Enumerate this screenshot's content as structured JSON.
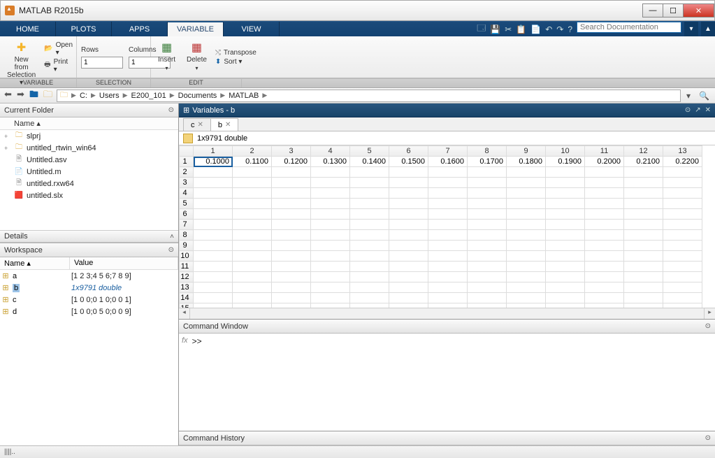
{
  "window": {
    "title": "MATLAB R2015b"
  },
  "tabs": {
    "home": "HOME",
    "plots": "PLOTS",
    "apps": "APPS",
    "variable": "VARIABLE",
    "view": "VIEW"
  },
  "toolstrip": {
    "newfrom": "New from\nSelection ▾",
    "open": "Open ▾",
    "print": "Print ▾",
    "rows": "Rows",
    "cols": "Columns",
    "rows_val": "1",
    "cols_val": "1",
    "insert": "Insert",
    "delete": "Delete",
    "transpose": "Transpose",
    "sort": "Sort ▾",
    "grp_variable": "VARIABLE",
    "grp_selection": "SELECTION",
    "grp_edit": "EDIT"
  },
  "search": {
    "placeholder": "Search Documentation"
  },
  "path": {
    "segs": [
      "C:",
      "Users",
      "E200_101",
      "Documents",
      "MATLAB"
    ]
  },
  "panels": {
    "currentfolder": "Current Folder",
    "name": "Name ▴",
    "details": "Details",
    "workspace": "Workspace",
    "wsname": "Name ▴",
    "wsvalue": "Value",
    "variables": "Variables - b",
    "cmdwin": "Command Window",
    "cmdhist": "Command History"
  },
  "files": [
    {
      "exp": "+",
      "icon": "folder",
      "name": "slprj"
    },
    {
      "exp": "+",
      "icon": "folder",
      "name": "untitled_rtwin_win64"
    },
    {
      "exp": "",
      "icon": "file",
      "name": "Untitled.asv"
    },
    {
      "exp": "",
      "icon": "mfile",
      "name": "Untitled.m"
    },
    {
      "exp": "",
      "icon": "file",
      "name": "untitled.rxw64"
    },
    {
      "exp": "",
      "icon": "slx",
      "name": "untitled.slx"
    }
  ],
  "ws": [
    {
      "n": "a",
      "v": "[1 2 3;4 5 6;7 8 9]"
    },
    {
      "n": "b",
      "v": "1x9791 double",
      "sel": true
    },
    {
      "n": "c",
      "v": "[1 0 0;0 1 0;0 0 1]"
    },
    {
      "n": "d",
      "v": "[1 0 0;0 5 0;0 0 9]"
    }
  ],
  "var": {
    "tabs": [
      {
        "l": "c"
      },
      {
        "l": "b",
        "act": true
      }
    ],
    "dim": "1x9791 double",
    "cols": [
      1,
      2,
      3,
      4,
      5,
      6,
      7,
      8,
      9,
      10,
      11,
      12,
      13
    ],
    "rows": 16,
    "data": [
      [
        "0.1000",
        "0.1100",
        "0.1200",
        "0.1300",
        "0.1400",
        "0.1500",
        "0.1600",
        "0.1700",
        "0.1800",
        "0.1900",
        "0.2000",
        "0.2100",
        "0.2200"
      ]
    ]
  },
  "cmd": {
    "prompt": ">>"
  },
  "status": "||||.."
}
